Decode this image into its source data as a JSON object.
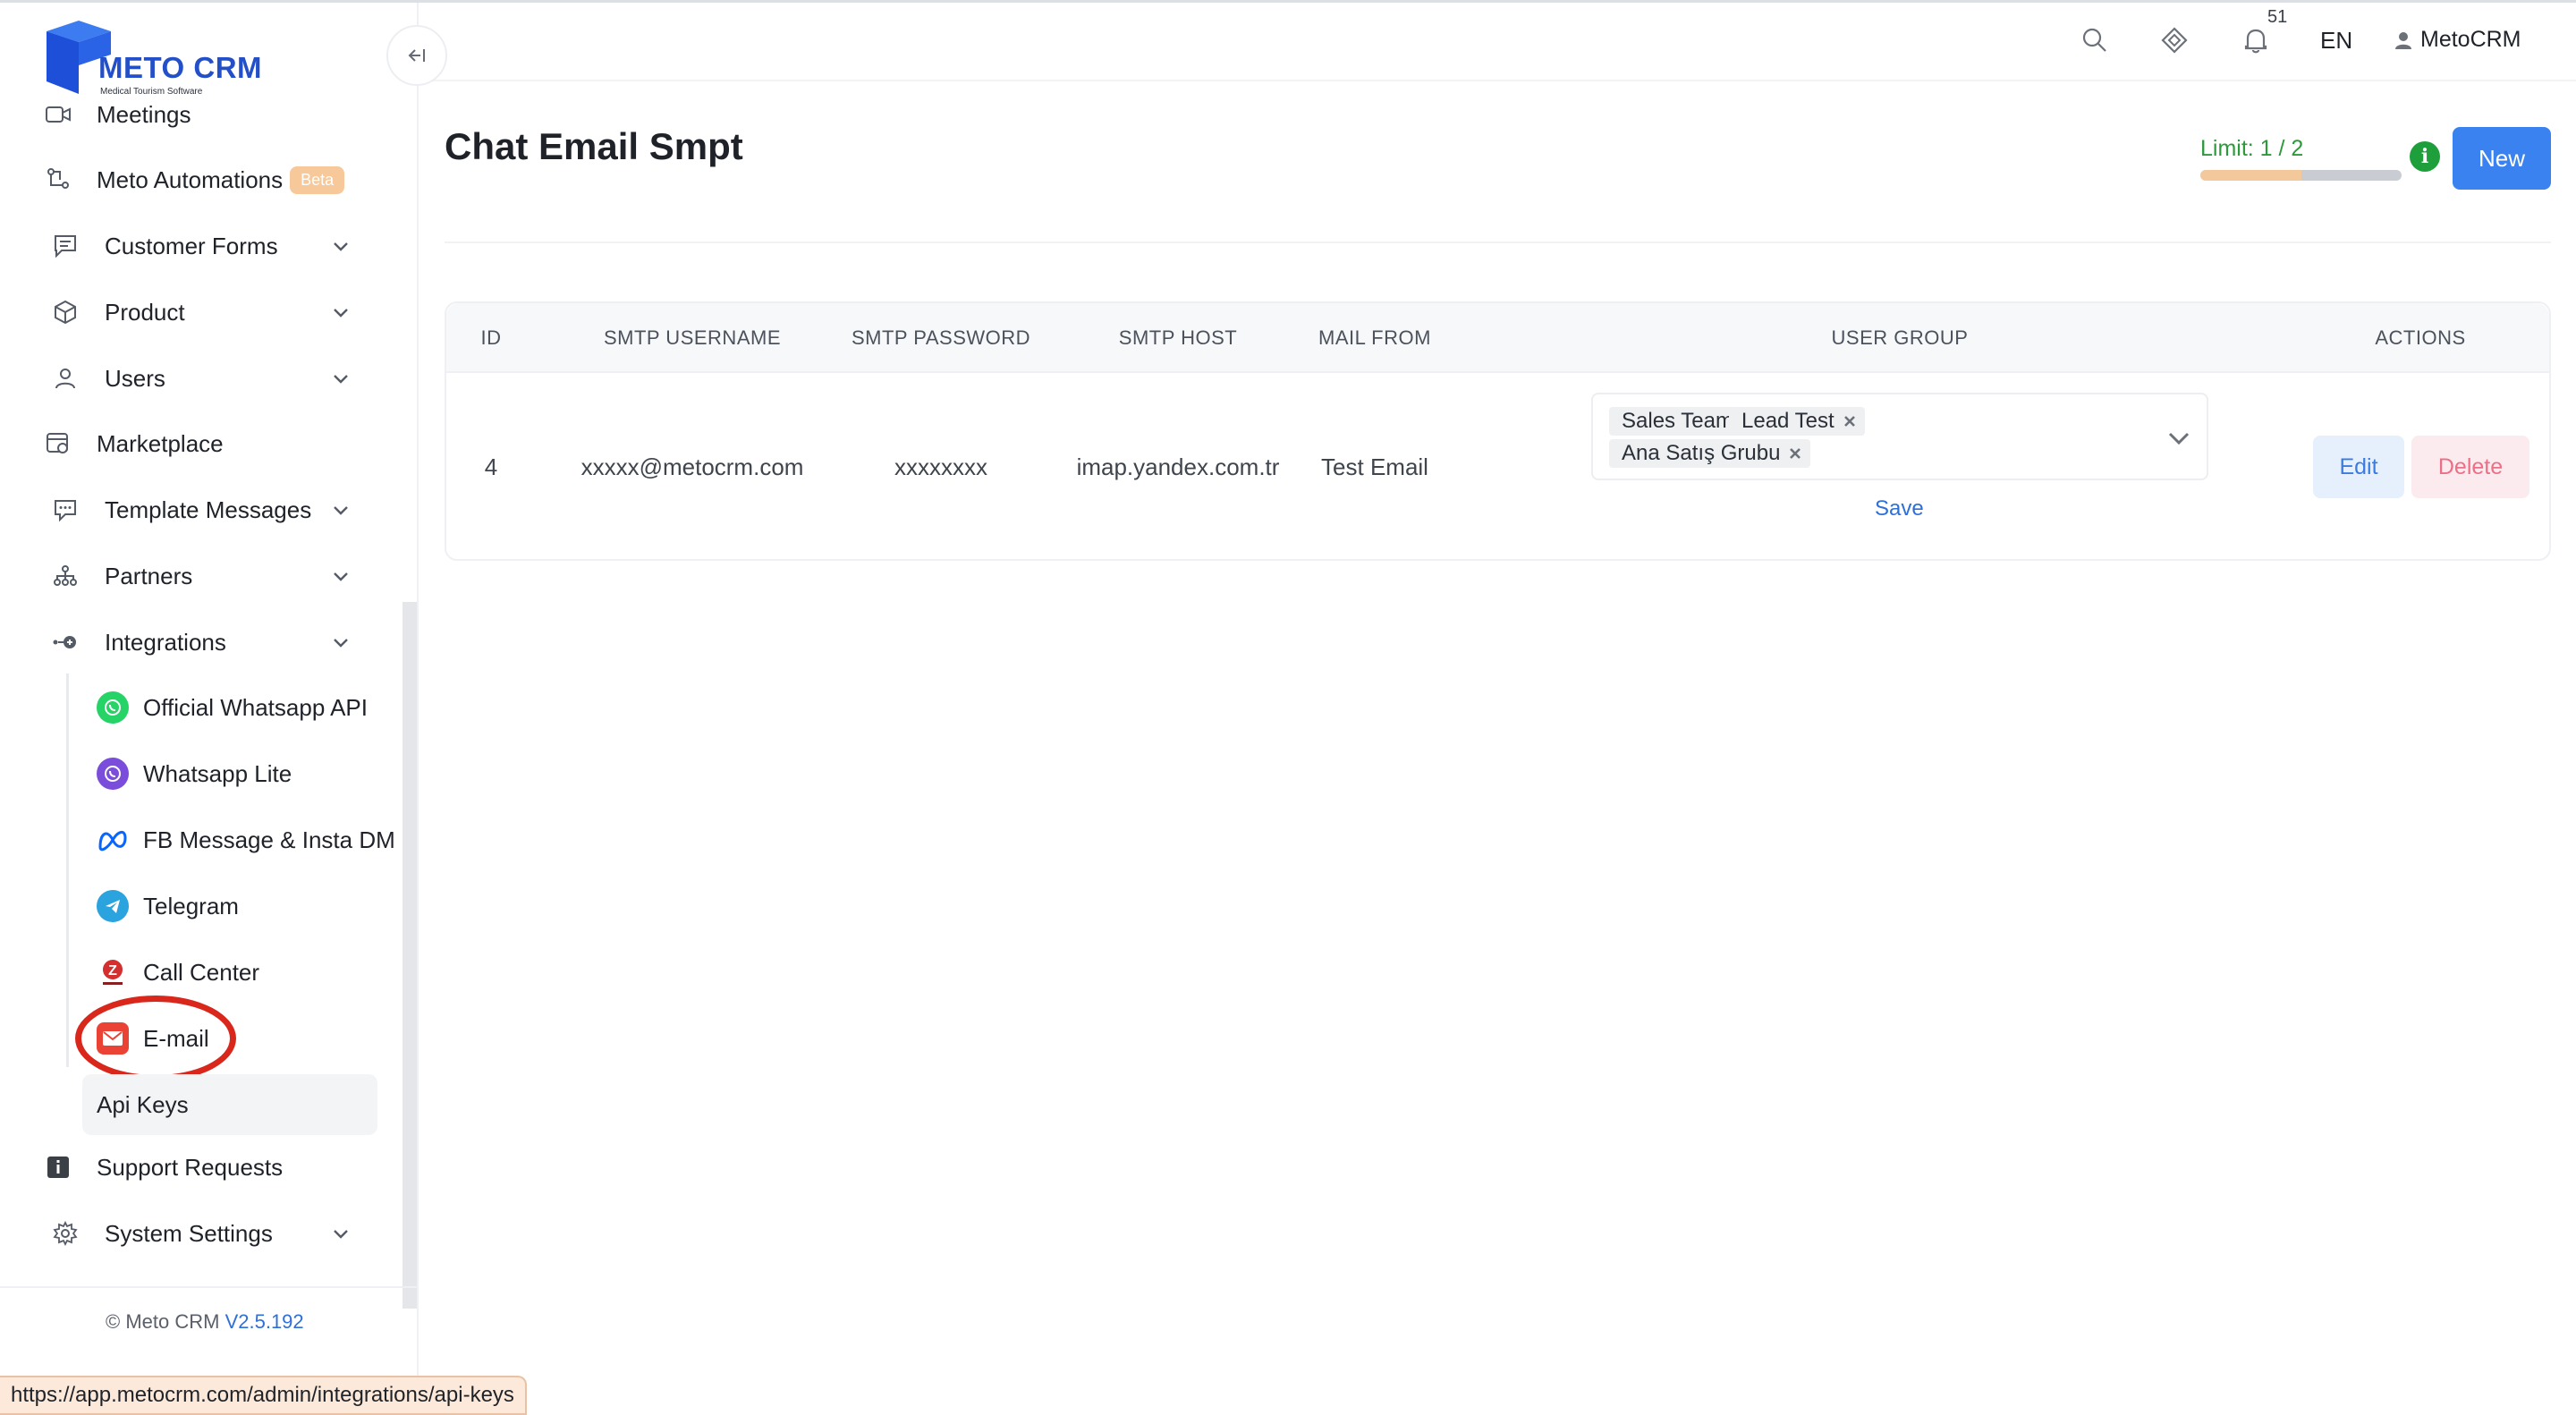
{
  "brand": {
    "title": "METO CRM",
    "subtitle": "Medical Tourism Software",
    "brand_color": "#2350c9"
  },
  "topbar": {
    "notification_count": "51",
    "language": "EN",
    "user": "MetoCRM",
    "icons": [
      "search-icon",
      "layers-icon",
      "bell-icon",
      "user-icon"
    ]
  },
  "sidebar": {
    "items": [
      {
        "id": "meetings",
        "label": "Meetings",
        "icon": "video-icon",
        "has_children": false
      },
      {
        "id": "meto-automations",
        "label": "Meto Automations",
        "badge": "Beta",
        "icon": "flow-icon",
        "has_children": false
      },
      {
        "id": "customer-forms",
        "label": "Customer Forms",
        "icon": "form-icon",
        "has_children": true
      },
      {
        "id": "product",
        "label": "Product",
        "icon": "box-icon",
        "has_children": true
      },
      {
        "id": "users",
        "label": "Users",
        "icon": "user-icon",
        "has_children": true
      },
      {
        "id": "marketplace",
        "label": "Marketplace",
        "icon": "store-icon",
        "has_children": false
      },
      {
        "id": "template-messages",
        "label": "Template Messages",
        "icon": "chat-icon",
        "has_children": true
      },
      {
        "id": "partners",
        "label": "Partners",
        "icon": "network-icon",
        "has_children": true
      },
      {
        "id": "integrations",
        "label": "Integrations",
        "icon": "plug-icon",
        "has_children": true,
        "expanded": true
      }
    ],
    "integrations_children": [
      {
        "id": "official-whatsapp-api",
        "label": "Official Whatsapp API",
        "icon": "whatsapp-icon",
        "color": "#25d366"
      },
      {
        "id": "whatsapp-lite",
        "label": "Whatsapp Lite",
        "icon": "whatsapp-lite-icon",
        "color": "#7b4ddb"
      },
      {
        "id": "fb-message-insta-dm",
        "label": "FB Message & Insta DM",
        "icon": "meta-icon",
        "color": "#0866ff"
      },
      {
        "id": "telegram",
        "label": "Telegram",
        "icon": "telegram-icon",
        "color": "#2aa3df"
      },
      {
        "id": "call-center",
        "label": "Call Center",
        "icon": "call-center-icon",
        "color": "#d32f2f"
      },
      {
        "id": "e-mail",
        "label": "E-mail",
        "icon": "mail-icon",
        "color": "#ea4335"
      }
    ],
    "api_keys": "Api Keys",
    "bottom_items": [
      {
        "id": "support-requests",
        "label": "Support Requests",
        "icon": "info-icon",
        "has_children": false
      },
      {
        "id": "system-settings",
        "label": "System Settings",
        "icon": "gear-icon",
        "has_children": true
      }
    ],
    "copyright": "© Meto CRM",
    "version": "V2.5.192"
  },
  "status_url": "https://app.metocrm.com/admin/integrations/api-keys",
  "main": {
    "title": "Chat Email Smpt",
    "limit_label": "Limit: 1 / 2",
    "limit_used": 1,
    "limit_total": 2,
    "limit_info": "i",
    "new_button": "New",
    "table": {
      "columns": [
        "ID",
        "SMTP USERNAME",
        "SMTP PASSWORD",
        "SMTP HOST",
        "MAIL FROM",
        "USER GROUP",
        "ACTIONS"
      ],
      "rows": [
        {
          "id": "4",
          "smtp_username": "xxxxx@metocrm.com",
          "smtp_password": "xxxxxxxx",
          "smtp_host": "imap.yandex.com.tr",
          "mail_from": "Test Email",
          "user_groups": [
            "Sales Team",
            "Lead Test",
            "Ana Satış Grubu"
          ],
          "save_label": "Save",
          "edit_label": "Edit",
          "delete_label": "Delete"
        }
      ]
    }
  },
  "colors": {
    "primary": "#3a82f0",
    "success": "#2c9a3a",
    "danger_text": "#ec6f87",
    "highlight": "#d9271c"
  }
}
